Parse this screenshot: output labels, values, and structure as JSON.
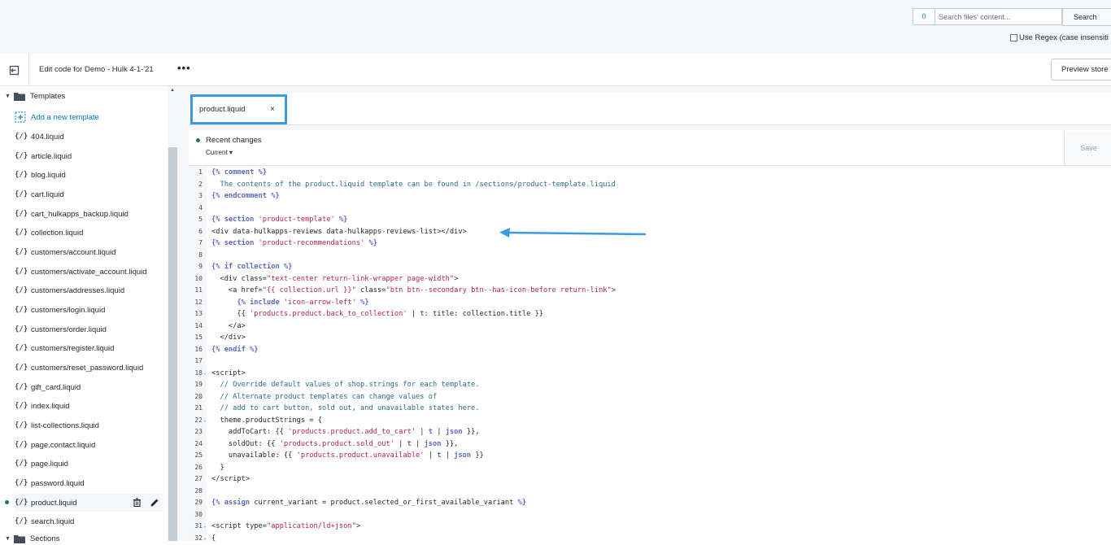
{
  "topbar": {
    "search_count": "0",
    "search_placeholder": "Search files' content...",
    "search_button": "Search",
    "regex_label": "Use Regex (case insensiti"
  },
  "header": {
    "title": "Edit code for Demo - Hulk 4-1-'21",
    "more": "•••",
    "preview_button": "Preview store"
  },
  "sidebar": {
    "folder_label": "Templates",
    "add_label": "Add a new template",
    "files": [
      "404.liquid",
      "article.liquid",
      "blog.liquid",
      "cart.liquid",
      "cart_hulkapps_backup.liquid",
      "collection.liquid",
      "customers/account.liquid",
      "customers/activate_account.liquid",
      "customers/addresses.liquid",
      "customers/login.liquid",
      "customers/order.liquid",
      "customers/register.liquid",
      "customers/reset_password.liquid",
      "gift_card.liquid",
      "index.liquid",
      "list-collections.liquid",
      "page.contact.liquid",
      "page.liquid",
      "password.liquid",
      "product.liquid",
      "search.liquid"
    ],
    "next_folder": "Sections"
  },
  "editor": {
    "tab_label": "product.liquid",
    "tab_close": "×",
    "recent_changes": "Recent changes",
    "current": "Current ▾",
    "save": "Save"
  },
  "colors": {
    "highlight": "#3a9be0",
    "link": "#007ace",
    "keyword": "#5c6ac4",
    "string": "#b3245a"
  }
}
